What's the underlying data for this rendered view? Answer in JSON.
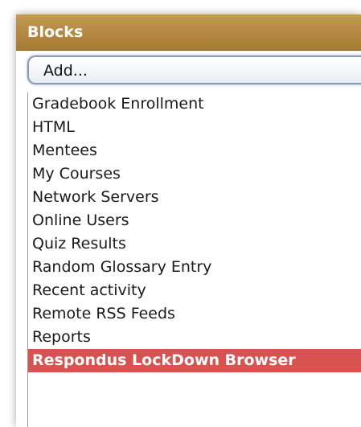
{
  "block": {
    "title": "Blocks",
    "select_value": "Add..."
  },
  "dropdown": {
    "options": [
      "Gradebook Enrollment",
      "HTML",
      "Mentees",
      "My Courses",
      "Network Servers",
      "Online Users",
      "Quiz Results",
      "Random Glossary Entry",
      "Recent activity",
      "Remote RSS Feeds",
      "Reports",
      "Respondus LockDown Browser"
    ],
    "highlighted_option": "Respondus LockDown Browser"
  },
  "colors": {
    "header": "#b48a42",
    "highlight": "#d8534f",
    "highlight_text": "#ffffff"
  }
}
